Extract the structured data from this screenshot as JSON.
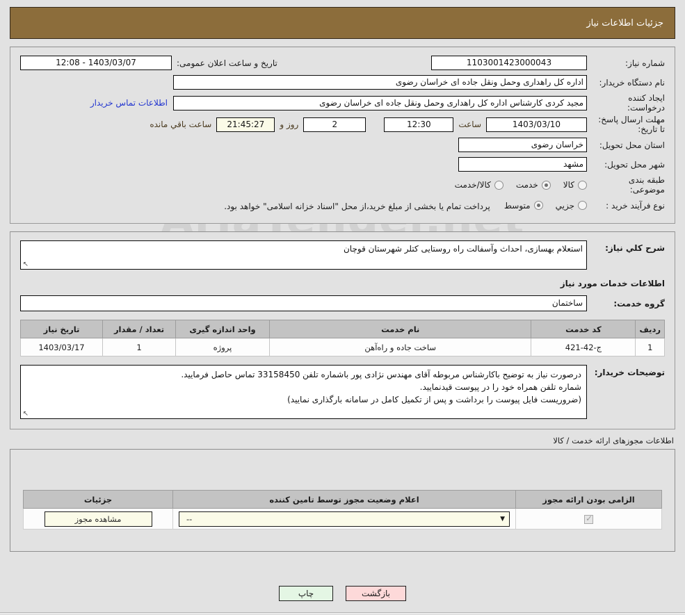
{
  "header": {
    "title": "جزئیات اطلاعات نیاز"
  },
  "colors": {
    "header_bg": "#8c6d3b",
    "page_bg": "#e2e2e2",
    "link": "#2336cf",
    "cream_field": "#fbfbe8",
    "print_btn": "#e4f6e4",
    "back_btn": "#fdd9d9",
    "table_header": "#c3c3c3"
  },
  "watermark": {
    "text": "AriaTender.net"
  },
  "form": {
    "need_number_label": "شماره نیاز:",
    "need_number_value": "1103001423000043",
    "announce_label": "تاریخ و ساعت اعلان عمومی:",
    "announce_value": "1403/03/07 - 12:08",
    "buyer_org_label": "نام دستگاه خریدار:",
    "buyer_org_value": "اداره کل راهداری وحمل ونقل جاده ای خراسان رضوی",
    "creator_label": "ایجاد کننده درخواست:",
    "creator_value": "مجید کردی کارشناس اداره کل راهداری وحمل ونقل جاده ای خراسان رضوی",
    "contact_link": "اطلاعات تماس خریدار",
    "deadline_label": "مهلت ارسال پاسخ: تا تاریخ:",
    "deadline_date": "1403/03/10",
    "deadline_hour_label": "ساعت",
    "deadline_hour": "12:30",
    "days_remaining": "2",
    "days_label": "روز و",
    "countdown": "21:45:27",
    "countdown_label": "ساعت باقي مانده",
    "province_label": "استان محل تحویل:",
    "province_value": "خراسان رضوی",
    "city_label": "شهر محل تحویل:",
    "city_value": "مشهد",
    "category_label": "طبقه بندی موضوعی:",
    "category_options": [
      {
        "label": "کالا",
        "selected": false
      },
      {
        "label": "خدمت",
        "selected": true
      },
      {
        "label": "کالا/خدمت",
        "selected": false
      }
    ],
    "process_label": "نوع فرآیند خرید :",
    "process_options": [
      {
        "label": "جزیي",
        "selected": false
      },
      {
        "label": "متوسط",
        "selected": true
      }
    ],
    "payment_note": "پرداخت تمام یا بخشی از مبلغ خرید،از محل \"اسناد خزانه اسلامی\" خواهد بود."
  },
  "description": {
    "label": "شرح كلي نياز:",
    "value": "استعلام بهسازی، احداث وآسفالت راه روستایی کتلر شهرستان قوچان"
  },
  "services_section": {
    "heading": "اطلاعات خدمات مورد نیاز",
    "group_label": "گروه خدمت:",
    "group_value": "ساختمان",
    "table": {
      "columns": [
        "ردیف",
        "کد خدمت",
        "نام خدمت",
        "واحد اندازه گیری",
        "تعداد / مقدار",
        "تاریخ نیاز"
      ],
      "rows": [
        {
          "index": "1",
          "code": "ج-42-421",
          "name": "ساخت جاده و راه‌آهن",
          "unit": "پروژه",
          "quantity": "1",
          "need_date": "1403/03/17"
        }
      ]
    }
  },
  "buyer_notes": {
    "label": "توضیحات خریدار:",
    "lines": [
      "درصورت نیاز به توضیح باکارشناس مربوطه آقای مهندس نژادی پور باشماره تلفن 33158450 تماس حاصل فرمایید.",
      "شماره تلفن همراه خود را در پیوست قیدنمایید.",
      "(ضروریست فایل پیوست را برداشت و پس از تکمیل کامل در سامانه بارگذاری نمایید)"
    ]
  },
  "permits_section": {
    "heading": "اطلاعات مجوزهای ارائه خدمت / کالا",
    "columns": [
      "الزامی بودن ارائه مجوز",
      "اعلام وضعیت مجوز توسط تامین کننده",
      "جزئیات"
    ],
    "rows": [
      {
        "required_checked": true,
        "status_value": "--",
        "details_button": "مشاهده مجوز"
      }
    ]
  },
  "footer": {
    "print_label": "چاپ",
    "back_label": "بازگشت"
  }
}
